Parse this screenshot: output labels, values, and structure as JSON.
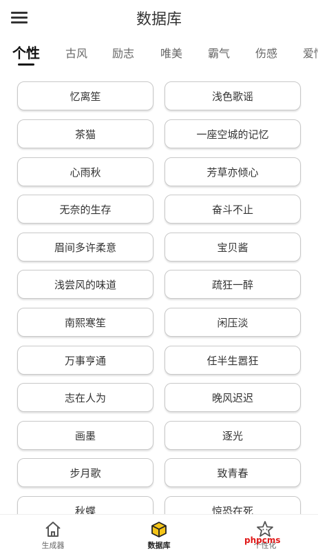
{
  "header": {
    "title": "数据库"
  },
  "tabs": [
    {
      "label": "个性",
      "active": true
    },
    {
      "label": "古风"
    },
    {
      "label": "励志"
    },
    {
      "label": "唯美"
    },
    {
      "label": "霸气"
    },
    {
      "label": "伤感"
    },
    {
      "label": "爱情"
    }
  ],
  "names": [
    [
      "忆离笙",
      "浅色歌谣"
    ],
    [
      "茶猫",
      "一座空城的记忆"
    ],
    [
      "心雨秋",
      "芳草亦倾心"
    ],
    [
      "无奈的生存",
      "奋斗不止"
    ],
    [
      "眉间多许柔意",
      "宝贝酱"
    ],
    [
      "浅尝风的味道",
      "疏狂一醉"
    ],
    [
      "南熙寒笙",
      "闲压淡"
    ],
    [
      "万事亨通",
      "任半生嚣狂"
    ],
    [
      "志在人为",
      "晚风迟迟"
    ],
    [
      "画墨",
      "逐光"
    ],
    [
      "步月歌",
      "致青春"
    ],
    [
      "秋蝶",
      "惊恐在死"
    ]
  ],
  "bottom_nav": {
    "items": [
      {
        "label": "生成器",
        "icon": "home-icon"
      },
      {
        "label": "数据库",
        "icon": "database-icon",
        "active": true
      },
      {
        "label": "个性化",
        "icon": "star-icon"
      }
    ]
  },
  "watermark": "phpcms",
  "colors": {
    "accent_yellow": "#f5c518",
    "watermark": "#e01818"
  }
}
